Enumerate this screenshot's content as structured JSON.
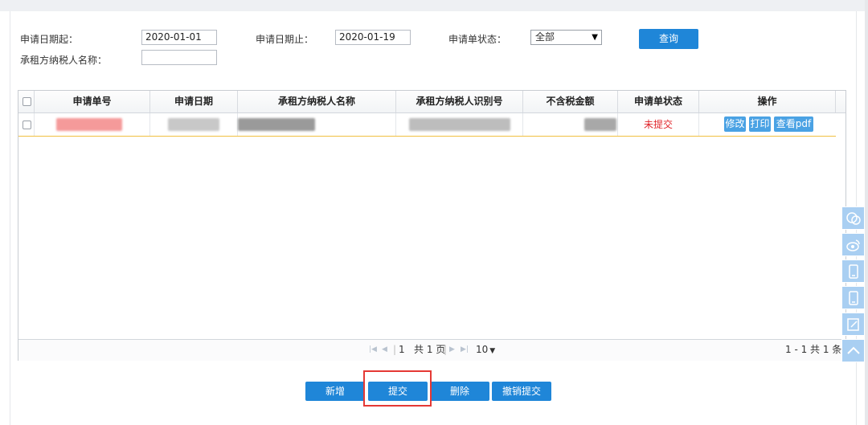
{
  "filters": {
    "start_date_label": "申请日期起：",
    "start_date_value": "2020-01-01",
    "end_date_label": "申请日期止：",
    "end_date_value": "2020-01-19",
    "status_label": "申请单状态：",
    "status_selected": "全部",
    "lessee_name_label": "承租方纳税人名称：",
    "lessee_name_value": "",
    "query_button": "查询"
  },
  "table": {
    "columns": [
      "申请单号",
      "申请日期",
      "承租方纳税人名称",
      "承租方纳税人识别号",
      "不含税金额",
      "申请单状态",
      "操作"
    ],
    "rows": [
      {
        "status": "未提交",
        "actions": [
          "修改",
          "打印",
          "查看pdf"
        ]
      }
    ]
  },
  "pager": {
    "page_number": "1",
    "total_pages_text": "共 1 页",
    "page_size": "10",
    "page_size_arrow": "▼",
    "range_text": "1 - 1   共 1 条"
  },
  "actions": {
    "add": "新增",
    "submit": "提交",
    "delete": "删除",
    "revoke_submit": "撤销提交"
  },
  "colors": {
    "primary_button": "#1f86d8",
    "status_unsubmitted": "#e0242a",
    "highlight_border": "#e53935",
    "row_underline": "#f0c040"
  },
  "side_dock_icons": [
    "chat-bubbles-icon",
    "weibo-icon",
    "mobile-icon",
    "mobile-icon",
    "edit-note-icon",
    "chevron-up-icon"
  ]
}
